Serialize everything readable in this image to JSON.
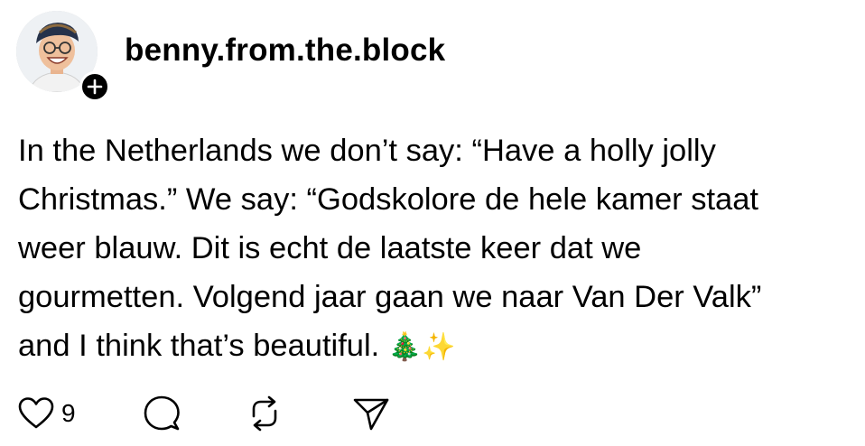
{
  "post": {
    "username": "benny.from.the.block",
    "text": "In the Netherlands we don’t say: “Have a holly jolly\nChristmas.” We say: “Godskolore de hele kamer staat\nweer blauw. Dit is echt de laatste keer dat we\ngourmetten. Volgend jaar gaan we naar Van Der Valk”\nand I think that’s beautiful. ",
    "emojis": "🎄✨",
    "like_count": "9"
  },
  "icons": {
    "follow": "plus-icon",
    "like": "heart-icon",
    "comment": "comment-bubble-icon",
    "repost": "repost-icon",
    "share": "send-icon"
  },
  "colors": {
    "text": "#000000",
    "background": "#ffffff",
    "badge": "#000000"
  }
}
